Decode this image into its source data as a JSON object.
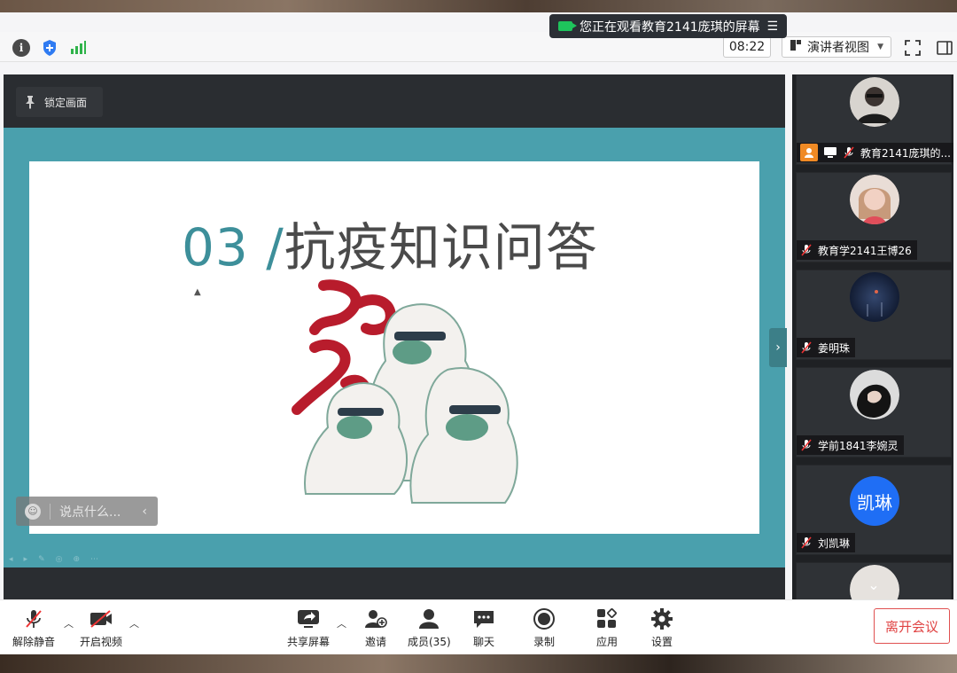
{
  "share_banner": {
    "text": "您正在观看教育2141庞琪的屏幕",
    "menu_icon": "menu-lines-icon"
  },
  "toolbar": {
    "timer": "08:22",
    "view_mode": "演讲者视图",
    "icons": [
      "info-icon",
      "shield-icon",
      "signal-icon",
      "fullscreen-icon",
      "sidebar-toggle-icon"
    ]
  },
  "stage": {
    "pin_label": "锁定画面",
    "slide": {
      "number": "03 /",
      "title": "抗疫知识问答"
    },
    "danmaku_placeholder": "说点什么..."
  },
  "participants": [
    {
      "name": "教育2141庞琪的...",
      "avatar": "photo",
      "is_host": true,
      "sharing": true,
      "muted": true
    },
    {
      "name": "教育学2141王博26",
      "avatar": "photo",
      "muted": true
    },
    {
      "name": "姜明珠",
      "avatar": "photo",
      "muted": true
    },
    {
      "name": "学前1841李婉灵",
      "avatar": "photo",
      "muted": true
    },
    {
      "name": "刘凯琳",
      "initials": "凯琳",
      "avatar_color": "#1f6ef5",
      "muted": true
    }
  ],
  "controls": {
    "unmute": "解除静音",
    "start_video": "开启视频",
    "share_screen": "共享屏幕",
    "invite": "邀请",
    "members": "成员(35)",
    "chat": "聊天",
    "record": "录制",
    "apps": "应用",
    "settings": "设置",
    "leave": "离开会议"
  },
  "colors": {
    "accent": "#1f6ef5",
    "danger": "#e04343",
    "slide_teal": "#4aa0ad",
    "host_orange": "#f08a24"
  }
}
